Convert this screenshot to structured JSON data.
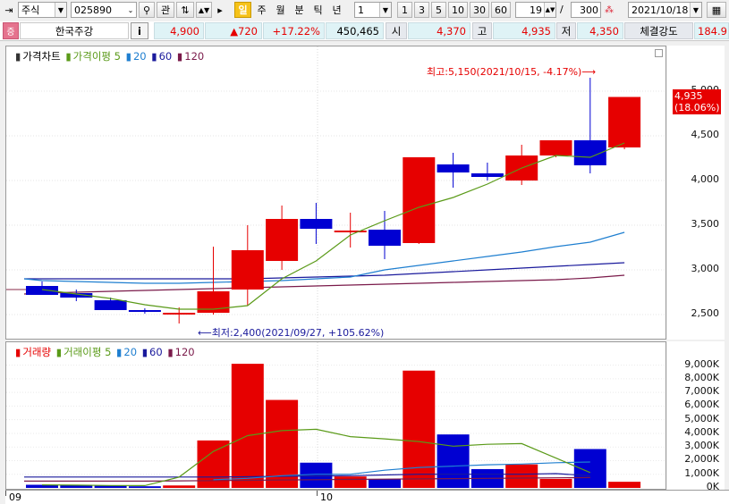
{
  "toolbar": {
    "market": "주식",
    "code": "025890",
    "btn_interest": "관",
    "periods": [
      "일",
      "주",
      "월",
      "분",
      "틱",
      "년"
    ],
    "period_select": "1",
    "intervals": [
      "1",
      "3",
      "5",
      "10",
      "30",
      "60"
    ],
    "count": "19",
    "total": "/",
    "total_value": "300",
    "date": "2021/10/18"
  },
  "info": {
    "name": "한국주강",
    "info_btn": "i",
    "price": "4,900",
    "change": "▲720",
    "change_pct": "+17.22%",
    "volume": "450,465",
    "open_label": "시",
    "open": "4,370",
    "high_label": "고",
    "high": "4,935",
    "low_label": "저",
    "low": "4,350",
    "strength_label": "체결강도",
    "strength": "184.9"
  },
  "price_legend": {
    "title": "가격차트",
    "ma5": "가격이평 5",
    "ma20": "20",
    "ma60": "60",
    "ma120": "120"
  },
  "volume_legend": {
    "title": "거래량",
    "ma5": "거래이평 5",
    "ma20": "20",
    "ma60": "60",
    "ma120": "120"
  },
  "annotations": {
    "high": "최고:5,150(2021/10/15, -4.17%)⟶",
    "low": "⟵최저:2,400(2021/09/27, +105.62%)"
  },
  "current_price_box": {
    "price": "4,935",
    "pct": "(18.06%)"
  },
  "price_ticks": [
    "5,000",
    "4,500",
    "4,000",
    "3,500",
    "3,000",
    "2,500"
  ],
  "volume_ticks": [
    "9,000K",
    "8,000K",
    "7,000K",
    "6,000K",
    "5,000K",
    "4,000K",
    "3,000K",
    "2,000K",
    "1,000K",
    "0K"
  ],
  "date_labels": [
    "09",
    "10"
  ],
  "colors": {
    "up": "#e60000",
    "down": "#0000d2",
    "ma5": "#5a9a18",
    "ma20": "#1f7fd0",
    "ma60": "#1a1a9c",
    "ma120": "#7a1a4a"
  },
  "chart_data": {
    "type": "candlestick",
    "candles": [
      {
        "o": 2820,
        "h": 2870,
        "l": 2720,
        "c": 2720,
        "v": 230
      },
      {
        "o": 2740,
        "h": 2780,
        "l": 2650,
        "c": 2690,
        "v": 230
      },
      {
        "o": 2660,
        "h": 2690,
        "l": 2550,
        "c": 2550,
        "v": 160
      },
      {
        "o": 2550,
        "h": 2570,
        "l": 2510,
        "c": 2535,
        "v": 120
      },
      {
        "o": 2500,
        "h": 2580,
        "l": 2400,
        "c": 2520,
        "v": 180
      },
      {
        "o": 2520,
        "h": 3260,
        "l": 2500,
        "c": 2760,
        "v": 3480
      },
      {
        "o": 2780,
        "h": 3500,
        "l": 2600,
        "c": 3220,
        "v": 9100
      },
      {
        "o": 3100,
        "h": 3720,
        "l": 3000,
        "c": 3570,
        "v": 6450
      },
      {
        "o": 3570,
        "h": 3750,
        "l": 3290,
        "c": 3460,
        "v": 1850
      },
      {
        "o": 3420,
        "h": 3640,
        "l": 3250,
        "c": 3440,
        "v": 840
      },
      {
        "o": 3450,
        "h": 3660,
        "l": 3120,
        "c": 3270,
        "v": 660
      },
      {
        "o": 3300,
        "h": 4260,
        "l": 3290,
        "c": 4260,
        "v": 8600
      },
      {
        "o": 4180,
        "h": 4310,
        "l": 3920,
        "c": 4090,
        "v": 3920
      },
      {
        "o": 4080,
        "h": 4200,
        "l": 4000,
        "c": 4040,
        "v": 1380
      },
      {
        "o": 4000,
        "h": 4400,
        "l": 3950,
        "c": 4280,
        "v": 1720
      },
      {
        "o": 4280,
        "h": 4450,
        "l": 4260,
        "c": 4450,
        "v": 660
      },
      {
        "o": 4450,
        "h": 5150,
        "l": 4080,
        "c": 4170,
        "v": 2850
      },
      {
        "o": 4370,
        "h": 4935,
        "l": 4350,
        "c": 4935,
        "v": 450
      }
    ],
    "ma5": [
      null,
      2780,
      2730,
      2680,
      2610,
      2560,
      2560,
      2600,
      2900,
      3100,
      3390,
      3550,
      3700,
      3810,
      3960,
      4140,
      4280,
      4260,
      4420
    ],
    "ma20": [
      2900,
      2880,
      2870,
      2860,
      2850,
      2850,
      2860,
      2870,
      2880,
      2900,
      2920,
      3000,
      3050,
      3100,
      3150,
      3200,
      3260,
      3310,
      3420
    ],
    "ma60": [
      2900,
      2900,
      2900,
      2900,
      2900,
      2900,
      2900,
      2900,
      2910,
      2920,
      2930,
      2940,
      2960,
      2980,
      3000,
      3020,
      3040,
      3060,
      3080
    ],
    "ma120": [
      2730,
      2740,
      2750,
      2760,
      2770,
      2780,
      2790,
      2800,
      2810,
      2820,
      2830,
      2840,
      2850,
      2860,
      2870,
      2880,
      2890,
      2910,
      2940
    ],
    "vma5": [
      null,
      220,
      200,
      180,
      170,
      790,
      2670,
      3830,
      4200,
      4300,
      3760,
      3600,
      3400,
      3060,
      3200,
      3250,
      2190,
      1130,
      null
    ],
    "vma20": [
      null,
      null,
      null,
      null,
      null,
      null,
      600,
      700,
      900,
      1000,
      1000,
      1300,
      1500,
      1600,
      1700,
      1750,
      1850,
      1900,
      null
    ],
    "vma60": [
      800,
      800,
      800,
      800,
      800,
      800,
      800,
      820,
      850,
      880,
      900,
      950,
      1000,
      1000,
      1000,
      1000,
      1050,
      900,
      null
    ],
    "vma120": [
      500,
      500,
      500,
      500,
      500,
      520,
      540,
      560,
      580,
      600,
      620,
      640,
      660,
      680,
      700,
      720,
      740,
      760,
      null
    ],
    "price_range": [
      2300,
      5300
    ],
    "volume_range": [
      0,
      9500
    ]
  }
}
